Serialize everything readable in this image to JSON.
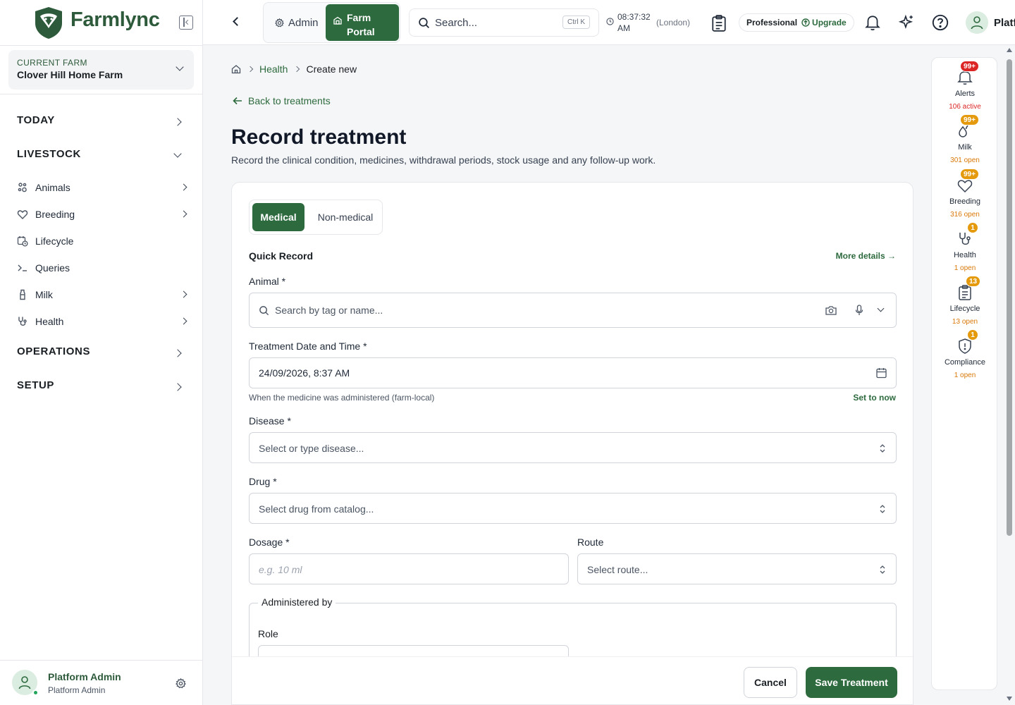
{
  "brand": {
    "name": "Farmlync",
    "color": "#2d5a3a"
  },
  "farm": {
    "label": "CURRENT FARM",
    "name": "Clover Hill Home Farm"
  },
  "nav": {
    "today": "TODAY",
    "livestock": "LIVESTOCK",
    "items": [
      {
        "label": "Animals",
        "icon": "animals-icon"
      },
      {
        "label": "Breeding",
        "icon": "heart-icon"
      },
      {
        "label": "Lifecycle",
        "icon": "calendar-clock-icon"
      },
      {
        "label": "Queries",
        "icon": "terminal-icon"
      },
      {
        "label": "Milk",
        "icon": "milk-bottle-icon"
      },
      {
        "label": "Health",
        "icon": "stethoscope-icon"
      }
    ],
    "operations": "OPERATIONS",
    "setup": "SETUP"
  },
  "user": {
    "name": "Platform Admin",
    "role": "Platform Admin",
    "top_name": "Platf"
  },
  "topbar": {
    "admin_label": "Admin",
    "farm_portal_line1": "Farm",
    "farm_portal_line2": "Portal",
    "search_placeholder": "Search...",
    "shortcut": "Ctrl K",
    "time_line1": "08:37:32",
    "time_line2": "AM",
    "timezone": "(London)",
    "plan": "Professional",
    "upgrade": "Upgrade"
  },
  "breadcrumb": {
    "section": "Health",
    "current": "Create new"
  },
  "back_link": "Back to treatments",
  "page": {
    "title": "Record treatment",
    "subtitle": "Record the clinical condition, medicines, withdrawal periods, stock usage and any follow-up work."
  },
  "form": {
    "tabs": {
      "medical": "Medical",
      "non_medical": "Non-medical"
    },
    "quick_record": "Quick Record",
    "more_details": "More details →",
    "animal_label": "Animal *",
    "animal_placeholder": "Search by tag or name...",
    "date_label": "Treatment Date and Time *",
    "date_value": "24/09/2026, 8:37 AM",
    "date_helper": "When the medicine was administered (farm-local)",
    "set_to_now": "Set to now",
    "disease_label": "Disease *",
    "disease_placeholder": "Select or type disease...",
    "drug_label": "Drug *",
    "drug_placeholder": "Select drug from catalog...",
    "dosage_label": "Dosage *",
    "dosage_placeholder": "e.g. 10 ml",
    "route_label": "Route",
    "route_placeholder": "Select route...",
    "administered_by": "Administered by",
    "role_label": "Role",
    "cancel": "Cancel",
    "save": "Save Treatment"
  },
  "rail": [
    {
      "name": "Alerts",
      "badge": "99+",
      "sub": "106 active",
      "color": "#dc2626",
      "icon": "bell-icon"
    },
    {
      "name": "Milk",
      "badge": "99+",
      "sub": "301 open",
      "color": "#e49a0c",
      "icon": "milk-drops-icon"
    },
    {
      "name": "Breeding",
      "badge": "99+",
      "sub": "316 open",
      "color": "#e49a0c",
      "icon": "heart-icon"
    },
    {
      "name": "Health",
      "badge": "1",
      "sub": "1 open",
      "color": "#e49a0c",
      "icon": "stethoscope-icon"
    },
    {
      "name": "Lifecycle",
      "badge": "13",
      "sub": "13 open",
      "color": "#e49a0c",
      "icon": "clipboard-icon"
    },
    {
      "name": "Compliance",
      "badge": "1",
      "sub": "1 open",
      "color": "#e49a0c",
      "icon": "shield-alert-icon"
    }
  ]
}
